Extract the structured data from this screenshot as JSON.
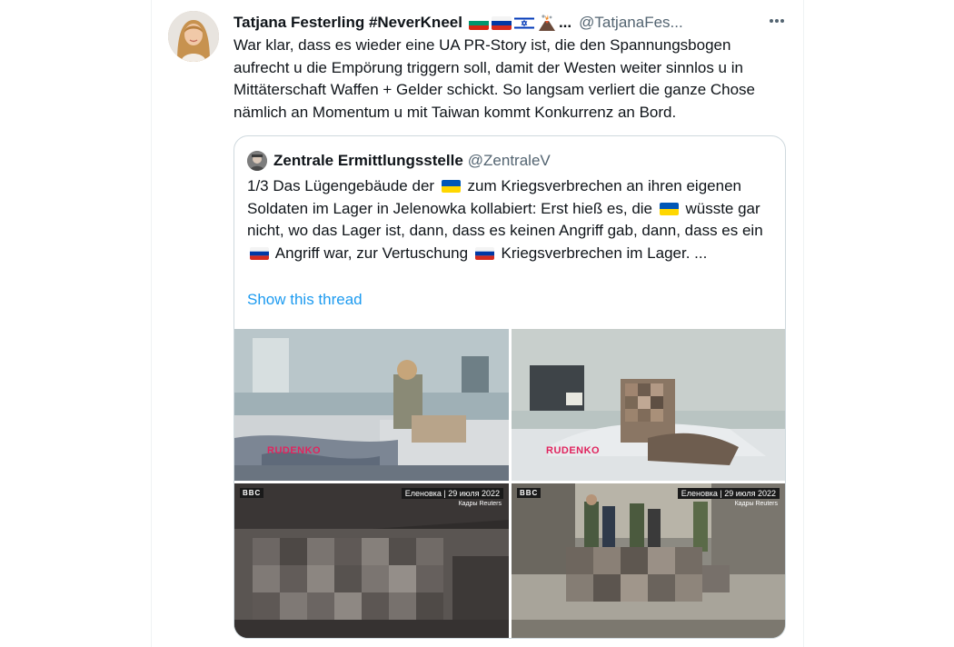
{
  "tweet": {
    "author_name": "Tatjana Festerling #NeverKneel",
    "trailing_ellipsis": "...",
    "handle": "@TatjanaFes...",
    "flag_icons": [
      "bulgaria-flag-icon",
      "russia-flag-icon",
      "israel-flag-icon",
      "volcano-icon"
    ],
    "text": "War klar, dass es wieder eine UA PR-Story ist, die den Spannungsbogen aufrecht u die Empörung triggern soll, damit der Westen weiter sinnlos u in Mittäterschaft Waffen + Gelder schickt. So langsam verliert die ganze Chose nämlich an Momentum u mit Taiwan kommt Konkurrenz an Bord.",
    "more_icon": "more-horizontal-icon"
  },
  "quoted": {
    "author_name": "Zentrale Ermittlungsstelle",
    "handle": "@ZentraleV",
    "text_parts": {
      "p1": "1/3 Das Lügengebäude der",
      "p2": "zum Kriegsverbrechen an ihren eigenen Soldaten im Lager in Jelenowka kollabiert: Erst hieß es, die",
      "p3": "wüsste gar nicht, wo das Lager ist, dann, dass es keinen Angriff gab, dann, dass es ein",
      "p4": "Angriff war, zur Vertuschung",
      "p5": "Kriegsverbrechen im Lager. ..."
    },
    "show_thread": "Show this thread"
  },
  "media": {
    "watermark_1": "RUDENKO",
    "watermark_2": "RUDENKO",
    "bbc_logo": "BBC",
    "caption_3": "Еленовка | 29 июля 2022",
    "credit_3": "Кадры Reuters",
    "caption_4": "Еленовка | 29 июля 2022",
    "credit_4": "Кадры Reuters"
  },
  "colors": {
    "link": "#1d9bf0",
    "secondary_text": "#536471",
    "border": "#cfd9de",
    "watermark": "#e0245e"
  }
}
